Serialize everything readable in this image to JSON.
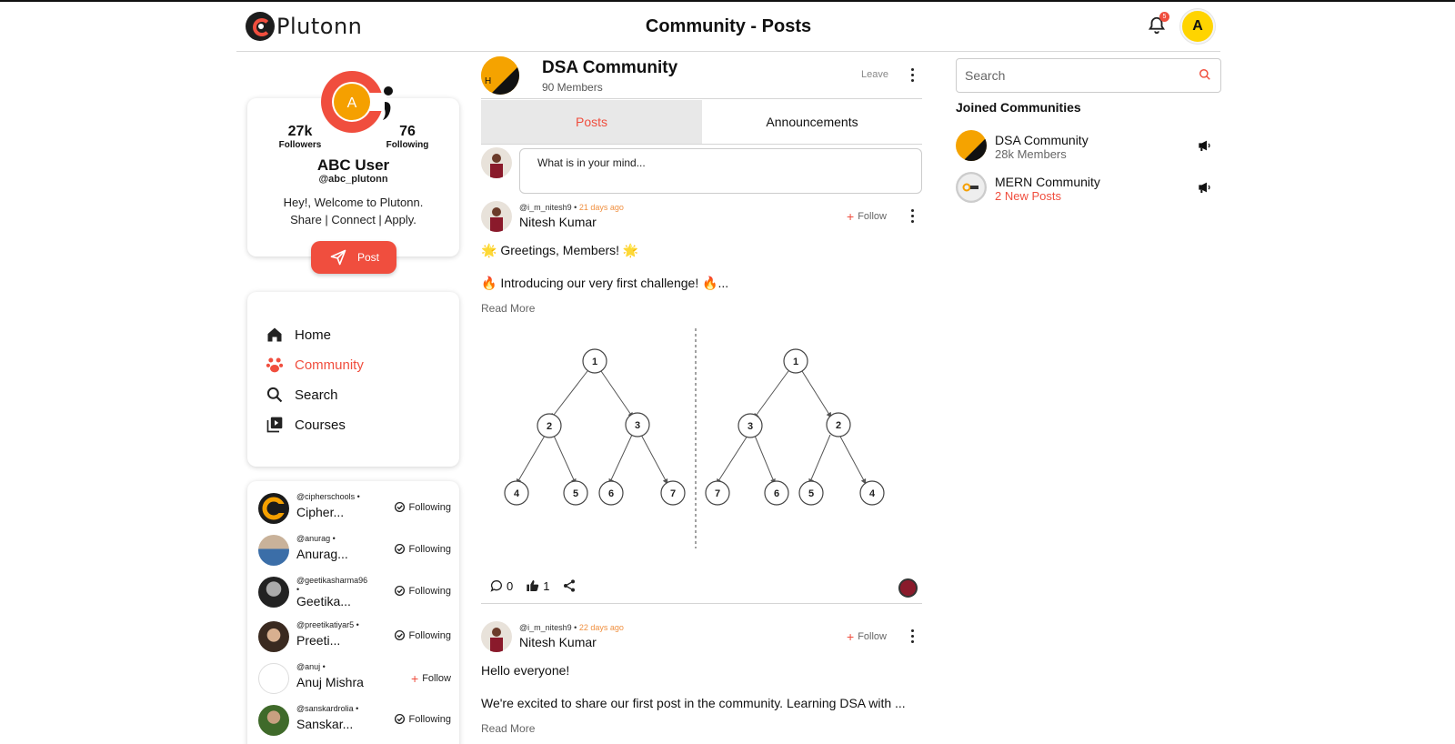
{
  "header": {
    "logo_text": "Plutonn",
    "title": "Community - Posts",
    "notification_count": "5",
    "avatar_initial": "A"
  },
  "profile": {
    "avatar_initial": "A",
    "followers_count": "27k",
    "followers_label": "Followers",
    "following_count": "76",
    "following_label": "Following",
    "name": "ABC User",
    "handle": "@abc_plutonn",
    "bio_line1": "Hey!, Welcome to Plutonn.",
    "bio_line2": "Share | Connect | Apply.",
    "post_button": "Post"
  },
  "nav": {
    "items": [
      {
        "label": "Home",
        "icon": "home-icon",
        "active": false
      },
      {
        "label": "Community",
        "icon": "community-icon",
        "active": true
      },
      {
        "label": "Search",
        "icon": "search-icon",
        "active": false
      },
      {
        "label": "Courses",
        "icon": "courses-icon",
        "active": false
      }
    ]
  },
  "following_list": [
    {
      "handle": "@cipherschools •",
      "name": "Cipher...",
      "status": "Following"
    },
    {
      "handle": "@anurag •",
      "name": "Anurag...",
      "status": "Following"
    },
    {
      "handle": "@geetikasharma96",
      "handle2": "•",
      "name": "Geetika...",
      "status": "Following"
    },
    {
      "handle": "@preetikatiyar5 •",
      "name": "Preeti...",
      "status": "Following"
    },
    {
      "handle": "@anuj •",
      "name": "Anuj Mishra",
      "status": "Follow"
    },
    {
      "handle": "@sanskardrolia •",
      "name": "Sanskar...",
      "status": "Following"
    }
  ],
  "community": {
    "name": "DSA Community",
    "members": "90 Members",
    "leave_label": "Leave",
    "tabs": [
      {
        "label": "Posts",
        "active": true
      },
      {
        "label": "Announcements",
        "active": false
      }
    ],
    "composer_placeholder": "What is in your mind..."
  },
  "posts": [
    {
      "handle": "@i_m_nitesh9 •",
      "time": "21 days ago",
      "author": "Nitesh Kumar",
      "follow_label": "Follow",
      "line1": "🌟 Greetings, Members! 🌟",
      "line2": "🔥 Introducing our very first challenge! 🔥...",
      "read_more": "Read More",
      "comments": "0",
      "likes": "1",
      "tree_left": [
        "1",
        "2",
        "3",
        "4",
        "5",
        "6",
        "7"
      ],
      "tree_right": [
        "1",
        "3",
        "2",
        "7",
        "6",
        "5",
        "4"
      ]
    },
    {
      "handle": "@i_m_nitesh9 •",
      "time": "22 days ago",
      "author": "Nitesh Kumar",
      "follow_label": "Follow",
      "line1": "Hello everyone!",
      "line2": "We're excited to share our first post in the community. Learning DSA with ...",
      "read_more": "Read More"
    }
  ],
  "sidebar_right": {
    "search_placeholder": "Search",
    "joined_title": "Joined Communities",
    "communities": [
      {
        "name": "DSA Community",
        "sub": "28k Members",
        "sub_highlight": false
      },
      {
        "name": "MERN Community",
        "sub": "2 New Posts",
        "sub_highlight": true
      }
    ]
  },
  "colors": {
    "accent": "#f04e3e",
    "avatar_yellow": "#ffd400",
    "time_orange": "#f09040"
  }
}
